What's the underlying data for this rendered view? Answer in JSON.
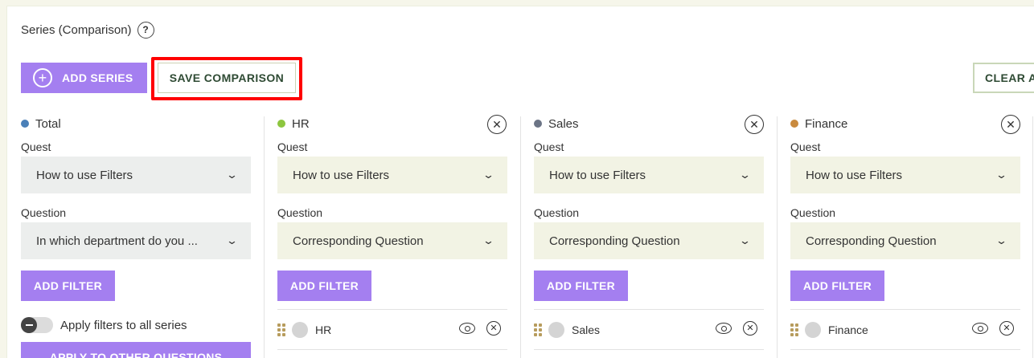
{
  "header": {
    "title": "Series (Comparison)",
    "help_icon": "?"
  },
  "toolbar": {
    "add_series_label": "ADD SERIES",
    "save_comparison_label": "SAVE COMPARISON",
    "clear_label": "CLEAR ALL"
  },
  "labels": {
    "quest": "Quest",
    "question": "Question",
    "add_filter": "ADD FILTER",
    "apply_all": "Apply filters to all series",
    "apply_other": "APPLY TO OTHER QUESTIONS"
  },
  "series": [
    {
      "name": "Total",
      "color": "#4a80b8",
      "quest": "How to use Filters",
      "question": "In which department do you ..."
    },
    {
      "name": "HR",
      "color": "#8dc63f",
      "quest": "How to use Filters",
      "question": "Corresponding Question",
      "filter": "HR"
    },
    {
      "name": "Sales",
      "color": "#6b7485",
      "quest": "How to use Filters",
      "question": "Corresponding Question",
      "filter": "Sales"
    },
    {
      "name": "Finance",
      "color": "#c98a3e",
      "quest": "How to use Filters",
      "question": "Corresponding Question",
      "filter": "Finance"
    }
  ],
  "colors": {
    "accent": "#a47ff0",
    "highlight": "#ff0000"
  },
  "icons": {
    "plus": "plus-circle-icon",
    "close": "close-circle-icon",
    "chevron": "chevron-down-icon",
    "eye": "eye-icon",
    "drag": "drag-handle-icon"
  }
}
